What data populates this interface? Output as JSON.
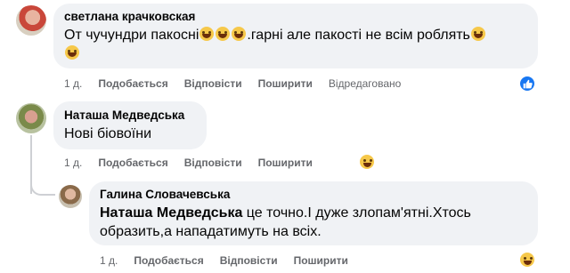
{
  "comments": [
    {
      "author": "светлана крачковская",
      "text_line1": "От чучундри пакосні",
      "text_line1_after": ".гарні але пакості не всім роблять",
      "time": "1 д.",
      "like": "Подобається",
      "reply": "Відповісти",
      "share": "Поширити",
      "edited": "Відредаговано",
      "reaction": "like-icon"
    },
    {
      "author": "Наташа Медведська",
      "text": "Нові біовоїни",
      "time": "1 д.",
      "like": "Подобається",
      "reply": "Відповісти",
      "share": "Поширити",
      "reaction": "laughing-emoji-icon"
    }
  ],
  "reply": {
    "author": "Галина Словачевська",
    "mention": "Наташа Медведська",
    "text_line1": " це точно.І дуже злопам'ятні.Хтось",
    "text_line2": "образить,а нападатимуть на всіх.",
    "time": "1 д.",
    "like": "Подобається",
    "reply": "Відповісти",
    "share": "Поширити",
    "reaction": "laughing-emoji-icon"
  },
  "colors": {
    "bubble": "#f0f2f5",
    "meta": "#65676b",
    "like_blue": "#1877f2",
    "thread": "#ced0d4"
  }
}
